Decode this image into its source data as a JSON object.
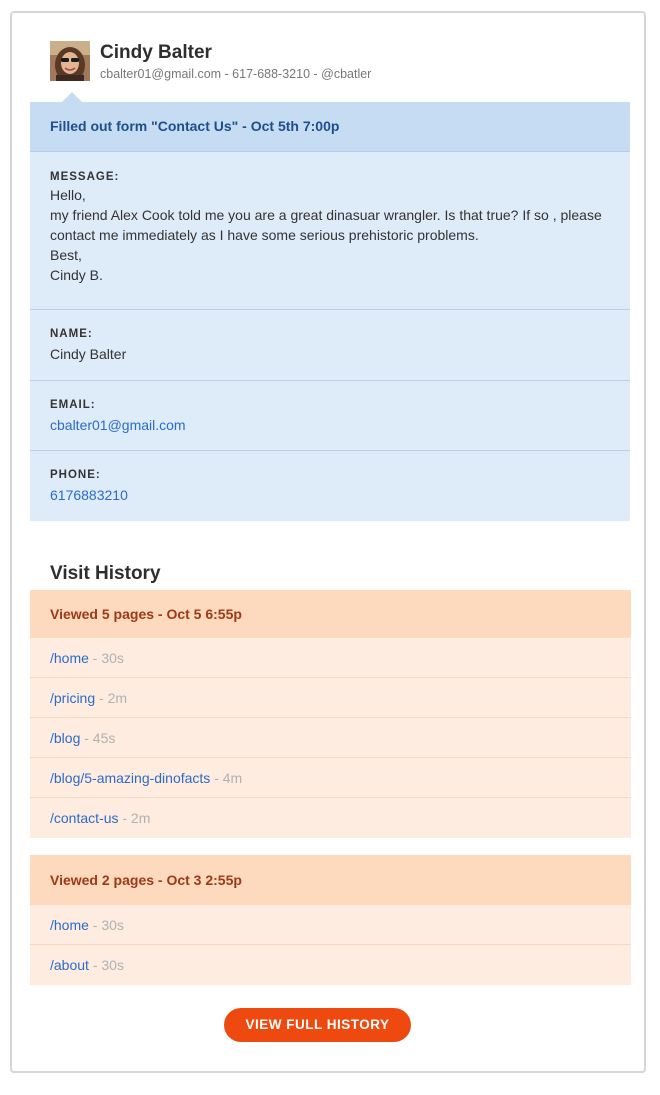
{
  "contact": {
    "name": "Cindy Balter",
    "info_line": "cbalter01@gmail.com - 617-688-3210 - @cbatler"
  },
  "form": {
    "title": "Filled out form \"Contact Us\" - Oct 5th 7:00p",
    "fields": {
      "message": {
        "label": "MESSAGE:",
        "lines": [
          "Hello,",
          "my friend Alex Cook told me you are a great dinasuar wrangler. Is that true? If so , please contact me immediately as I have some serious prehistoric problems.",
          "Best,",
          "Cindy B."
        ]
      },
      "name": {
        "label": "NAME:",
        "value": "Cindy Balter"
      },
      "email": {
        "label": "EMAIL:",
        "value": "cbalter01@gmail.com"
      },
      "phone": {
        "label": "PHONE:",
        "value": "6176883210"
      }
    }
  },
  "visit_history": {
    "title": "Visit History",
    "sessions": [
      {
        "heading": "Viewed 5 pages - Oct 5 6:55p",
        "pages": [
          {
            "path": "/home",
            "time": " - 30s"
          },
          {
            "path": "/pricing",
            "time": " - 2m"
          },
          {
            "path": "/blog",
            "time": " - 45s"
          },
          {
            "path": "/blog/5-amazing-dinofacts",
            "time": " - 4m"
          },
          {
            "path": "/contact-us",
            "time": " - 2m"
          }
        ]
      },
      {
        "heading": "Viewed 2 pages - Oct 3 2:55p",
        "pages": [
          {
            "path": "/home",
            "time": " - 30s"
          },
          {
            "path": "/about",
            "time": " - 30s"
          }
        ]
      }
    ]
  },
  "actions": {
    "view_full_history": "VIEW FULL HISTORY"
  },
  "colors": {
    "form_header_bg": "#c6dcf2",
    "form_body_bg": "#deebf9",
    "session_header_bg": "#fdd9bd",
    "session_body_bg": "#feece0",
    "link": "#2c6cc7",
    "button": "#ee4a10"
  }
}
